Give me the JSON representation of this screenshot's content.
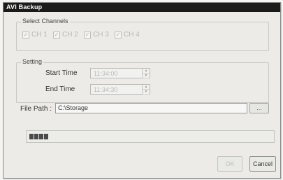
{
  "window": {
    "title": "AVI Backup"
  },
  "channels_group": {
    "title": "Select Channels",
    "channels": [
      {
        "label": "CH 1",
        "checked": true
      },
      {
        "label": "CH 2",
        "checked": true
      },
      {
        "label": "CH 3",
        "checked": true
      },
      {
        "label": "CH 4",
        "checked": true
      }
    ]
  },
  "setting_group": {
    "title": "Setting",
    "start_time": {
      "label": "Start Time",
      "value": "11:34:00"
    },
    "end_time": {
      "label": "End Time",
      "value": "11:34:30"
    }
  },
  "file_path": {
    "label": "File Path :",
    "value": "C:\\Storage",
    "browse_label": "..."
  },
  "progress": {
    "fraction": 0.08
  },
  "buttons": {
    "ok_label": "OK",
    "cancel_label": "Cancel"
  }
}
